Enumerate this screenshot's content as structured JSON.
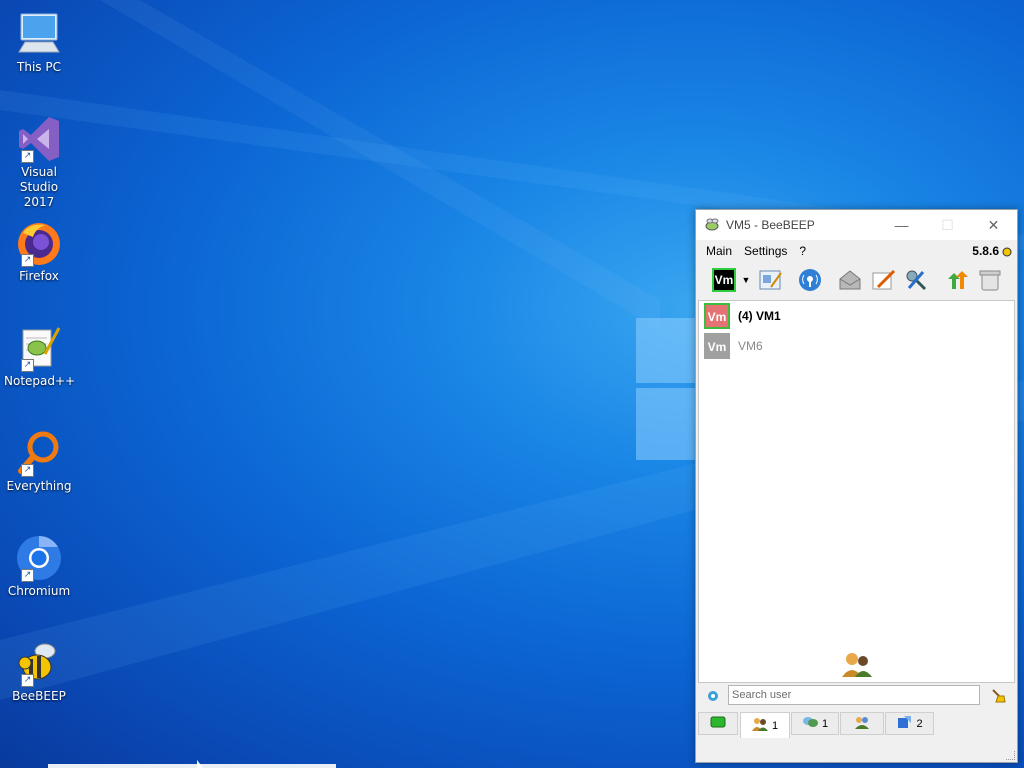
{
  "desktop": {
    "icons": [
      {
        "label": "This PC",
        "icon": "computer-icon"
      },
      {
        "label": "Visual Studio\n2017",
        "icon": "visual-studio-icon"
      },
      {
        "label": "Firefox",
        "icon": "firefox-icon"
      },
      {
        "label": "Notepad++",
        "icon": "notepadpp-icon"
      },
      {
        "label": "Everything",
        "icon": "everything-search-icon"
      },
      {
        "label": "Chromium",
        "icon": "chromium-icon"
      },
      {
        "label": "BeeBEEP",
        "icon": "bee-icon"
      }
    ]
  },
  "window": {
    "title": "VM5 - BeeBEEP",
    "minimize": "—",
    "maximize": "☐",
    "close": "✕",
    "menu": {
      "main": "Main",
      "settings": "Settings",
      "help": "?"
    },
    "version": "5.8.6",
    "toolbar": {
      "status_avatar": "Vm"
    },
    "users": [
      {
        "avatar": "Vm",
        "name": "(4) VM1",
        "online": true
      },
      {
        "avatar": "Vm",
        "name": "VM6",
        "online": false
      }
    ],
    "search": {
      "placeholder": "Search user"
    },
    "tabs": [
      {
        "icon": "network-icon",
        "count": ""
      },
      {
        "icon": "users-icon",
        "count": "1"
      },
      {
        "icon": "chat-icon",
        "count": "1"
      },
      {
        "icon": "groups-icon",
        "count": ""
      },
      {
        "icon": "files-icon",
        "count": "2"
      }
    ]
  },
  "colors": {
    "desktop_blue": "#0b64d2",
    "online_avatar": "#e57373",
    "online_border": "#3dbb3d",
    "offline_avatar": "#a0a0a0"
  }
}
